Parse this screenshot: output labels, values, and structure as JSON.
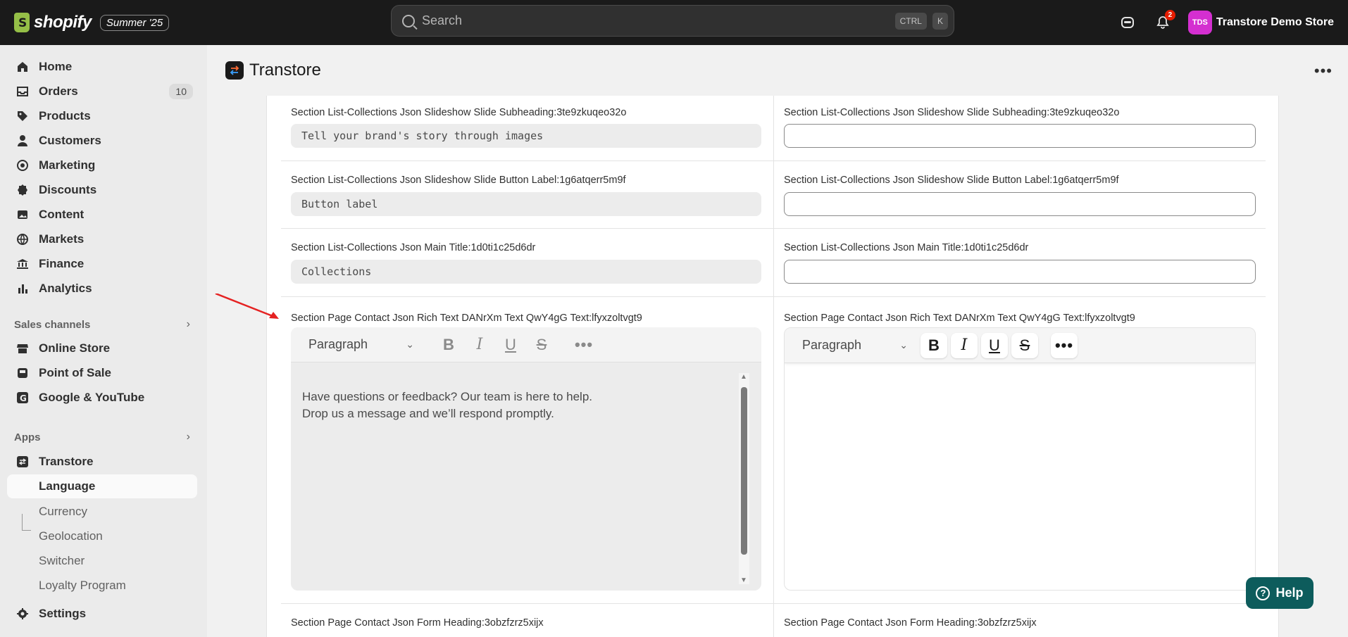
{
  "topbar": {
    "brand": "shopify",
    "edition": "Summer '25",
    "search_placeholder": "Search",
    "kbd_ctrl": "CTRL",
    "kbd_k": "K",
    "notification_count": "2",
    "avatar_initials": "TDS",
    "store_name": "Transtore Demo Store"
  },
  "sidebar": {
    "items": [
      {
        "label": "Home",
        "icon": "home-icon"
      },
      {
        "label": "Orders",
        "icon": "orders-icon",
        "count": "10"
      },
      {
        "label": "Products",
        "icon": "tag-icon"
      },
      {
        "label": "Customers",
        "icon": "person-icon"
      },
      {
        "label": "Marketing",
        "icon": "target-icon"
      },
      {
        "label": "Discounts",
        "icon": "discount-icon"
      },
      {
        "label": "Content",
        "icon": "image-icon"
      },
      {
        "label": "Markets",
        "icon": "globe-icon"
      },
      {
        "label": "Finance",
        "icon": "bank-icon"
      },
      {
        "label": "Analytics",
        "icon": "bar-chart-icon"
      }
    ],
    "sales_channels_heading": "Sales channels",
    "channels": [
      {
        "label": "Online Store",
        "icon": "store-icon"
      },
      {
        "label": "Point of Sale",
        "icon": "pos-icon"
      },
      {
        "label": "Google & YouTube",
        "icon": "google-icon"
      }
    ],
    "apps_heading": "Apps",
    "app": {
      "label": "Transtore",
      "icon": "transtore-icon"
    },
    "app_subitems": [
      "Language",
      "Currency",
      "Geolocation",
      "Switcher",
      "Loyalty Program"
    ],
    "settings": {
      "label": "Settings",
      "icon": "gear-icon"
    }
  },
  "header": {
    "title": "Transtore"
  },
  "rows": [
    {
      "label": "Section List-Collections Json Slideshow Slide Subheading:3te9zkuqeo32o",
      "source_value": "Tell your brand's story through images"
    },
    {
      "label": "Section List-Collections Json Slideshow Slide Button Label:1g6atqerr5m9f",
      "source_value": "Button label"
    },
    {
      "label": "Section List-Collections Json Main Title:1d0ti1c25d6dr",
      "source_value": "Collections"
    }
  ],
  "rich_text_row": {
    "label": "Section Page Contact Json Rich Text DANrXm Text QwY4gG Text:lfyxzoltvgt9",
    "paragraph_select": "Paragraph",
    "source_line1": "Have questions or feedback? Our team is here to help.",
    "source_line2": "Drop us a message and we’ll respond promptly."
  },
  "last_row": {
    "label": "Section Page Contact Json Form Heading:3obzfzrz5xijx"
  },
  "toolbar": {
    "bold": "B",
    "italic": "I",
    "underline": "U",
    "strike": "S",
    "more": "•••"
  },
  "help_label": "Help",
  "colors": {
    "topbar_bg": "#1a1a1a",
    "help_bg": "#0d5c5c",
    "avatar_bg": "#d42fd0",
    "arrow": "#e52222"
  }
}
